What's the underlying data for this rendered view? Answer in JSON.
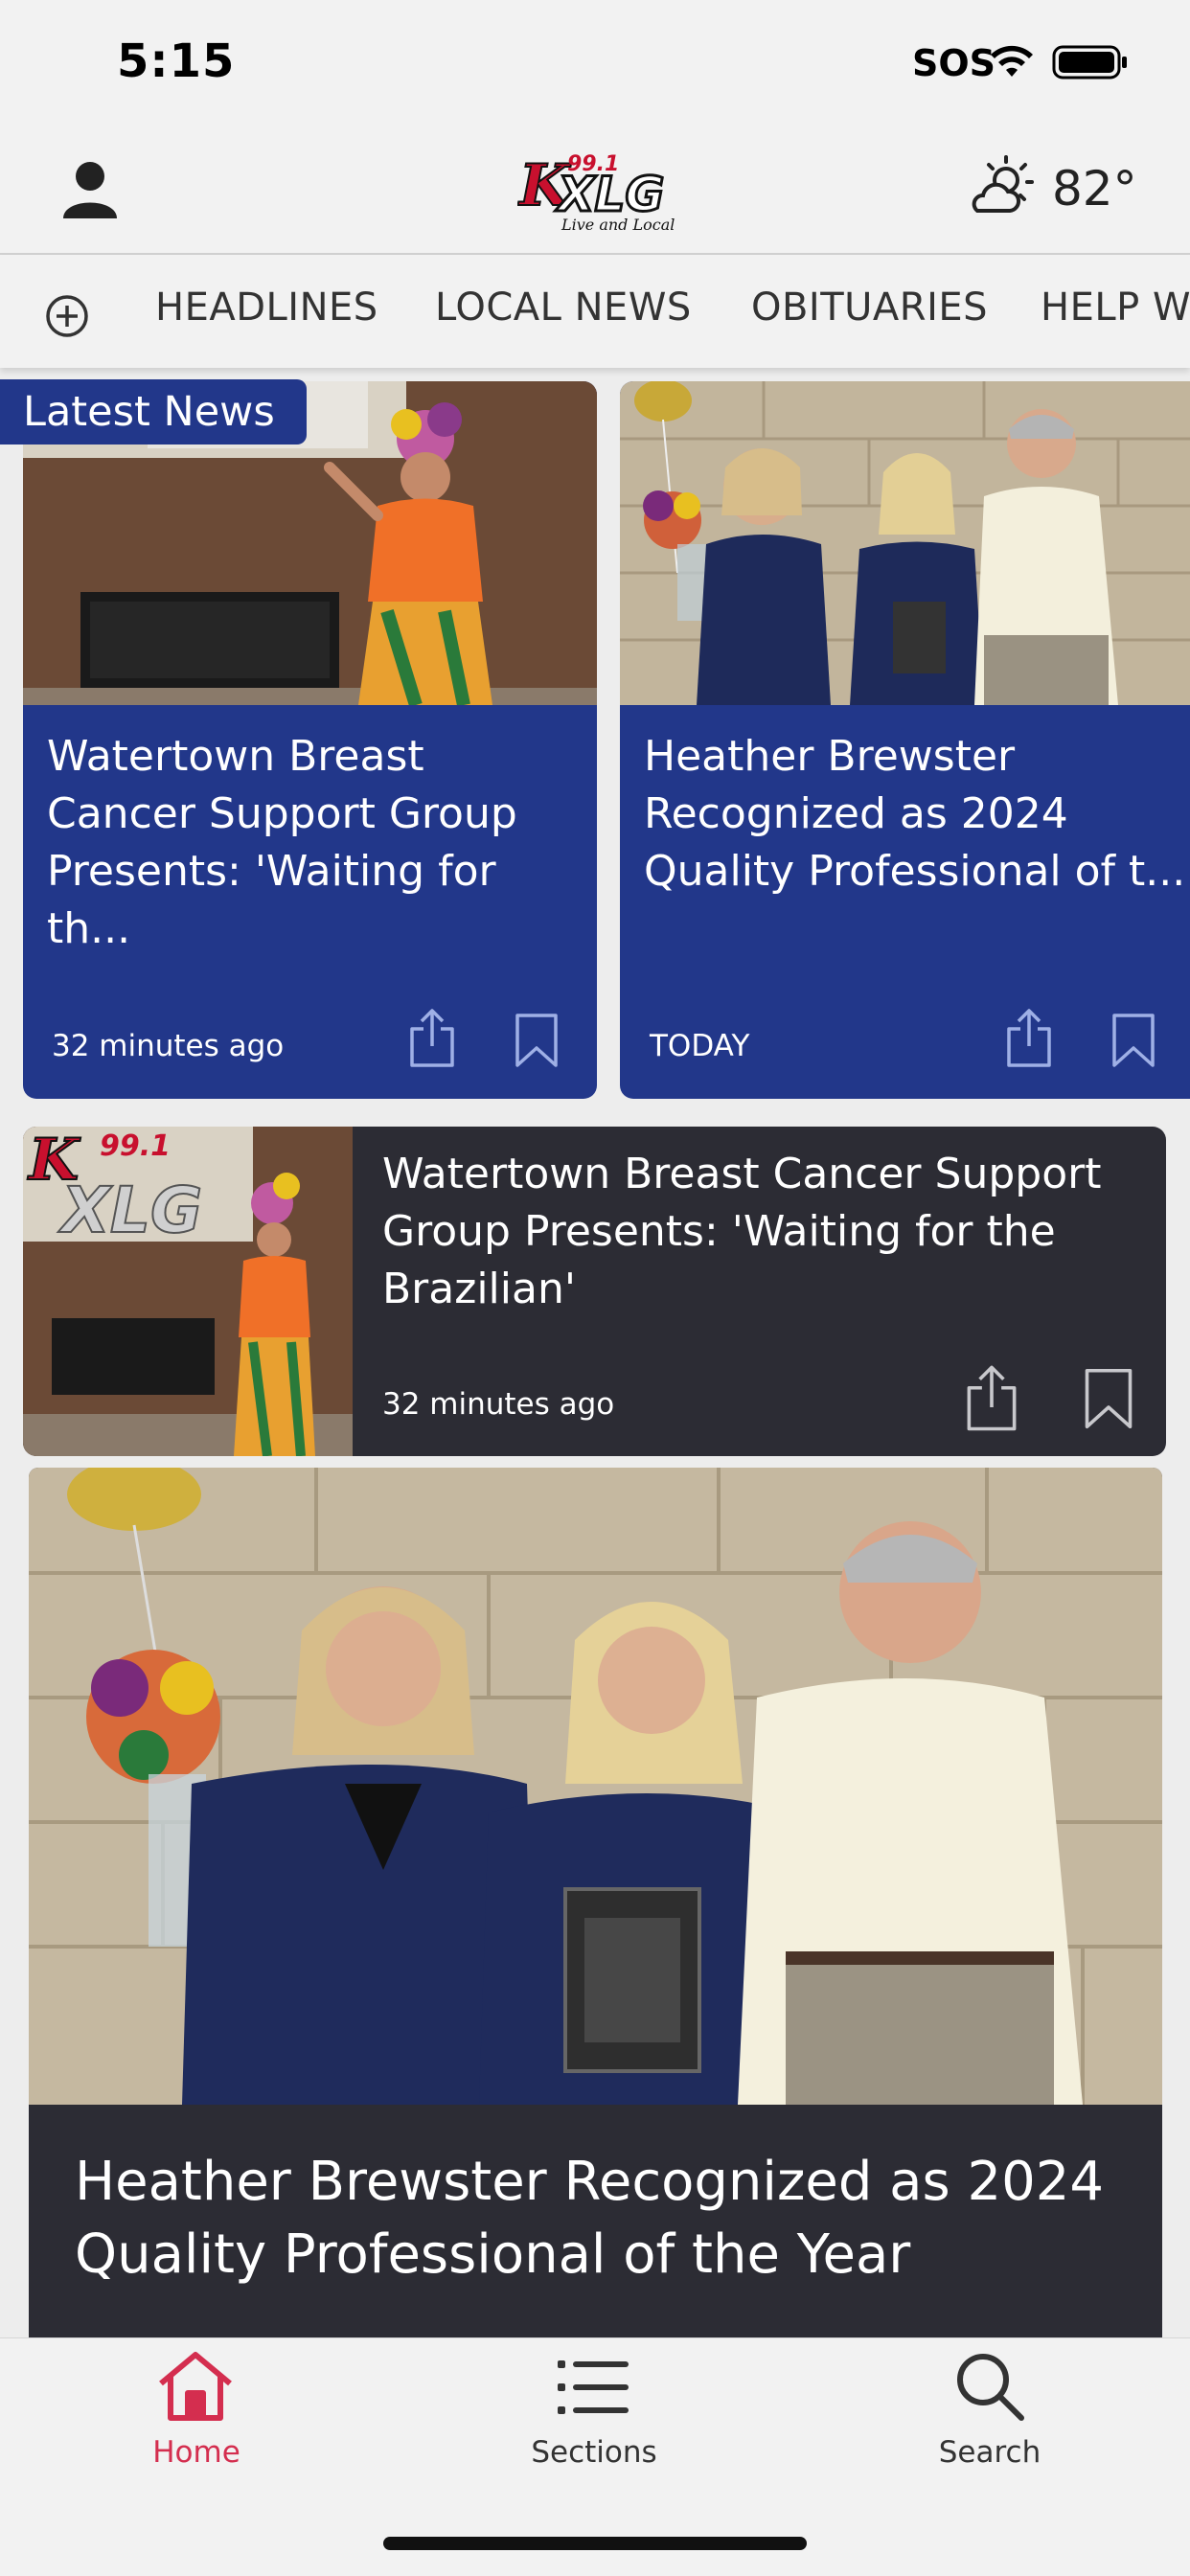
{
  "status_bar": {
    "time": "5:15",
    "sos": "SOS"
  },
  "header": {
    "logo_text": "KXLG",
    "logo_freq": "99.1",
    "logo_tagline": "Live and Local",
    "temperature": "82°"
  },
  "nav": {
    "items": [
      "HEADLINES",
      "LOCAL NEWS",
      "OBITUARIES",
      "HELP W"
    ]
  },
  "section_badge": "Latest News",
  "cards": [
    {
      "title": "Watertown Breast Cancer Support Group Presents: 'Waiting for th...",
      "meta": "32 minutes ago"
    },
    {
      "title": "Heather Brewster Recognized as 2024 Quality Professional of t...",
      "meta": "TODAY"
    }
  ],
  "list_item": {
    "title": "Watertown Breast Cancer Support Group Presents: 'Waiting for the Brazilian'",
    "meta": "32 minutes ago"
  },
  "feature": {
    "title": "Heather Brewster Recognized as 2024 Quality Professional of the Year"
  },
  "tabs": {
    "home": "Home",
    "sections": "Sections",
    "search": "Search"
  },
  "colors": {
    "brand_blue": "#22378a",
    "dark_card": "#2c2c34",
    "accent_red": "#d42e4f"
  },
  "icons": [
    "person-icon",
    "partly-sunny-icon",
    "plus-circle-icon",
    "share-icon",
    "bookmark-icon",
    "home-icon",
    "list-icon",
    "search-icon"
  ]
}
